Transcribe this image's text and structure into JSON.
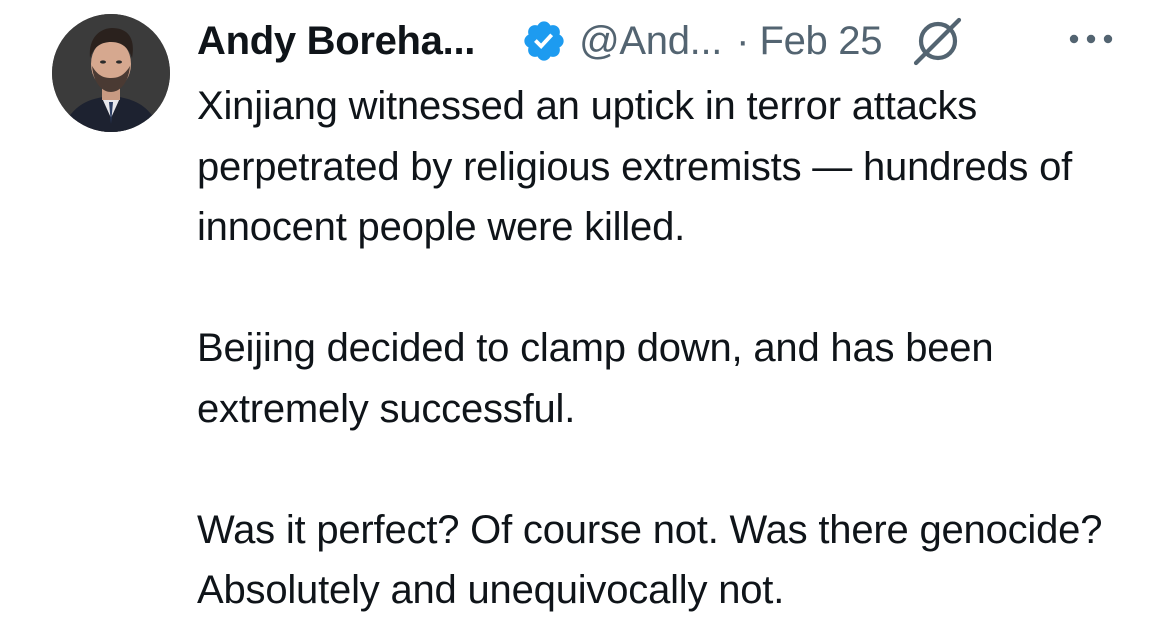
{
  "tweet": {
    "author_name": "Andy Boreha...",
    "handle": "@And...",
    "separator": "·",
    "date": "Feb 25",
    "verified": true,
    "icons": {
      "avatar": "avatar",
      "verified": "verified-badge-icon",
      "grok": "grok-icon",
      "more": "more-options-icon"
    },
    "colors": {
      "verified": "#1d9bf0",
      "text": "#0f1419",
      "secondary": "#536471"
    },
    "paragraphs": [
      "Xinjiang witnessed an uptick in terror attacks perpetrated by religious extremists — hundreds of innocent people were killed.",
      "Beijing decided to clamp down, and has been extremely successful.",
      "Was it perfect? Of course not. Was there genocide? Absolutely and unequivocally not."
    ]
  }
}
